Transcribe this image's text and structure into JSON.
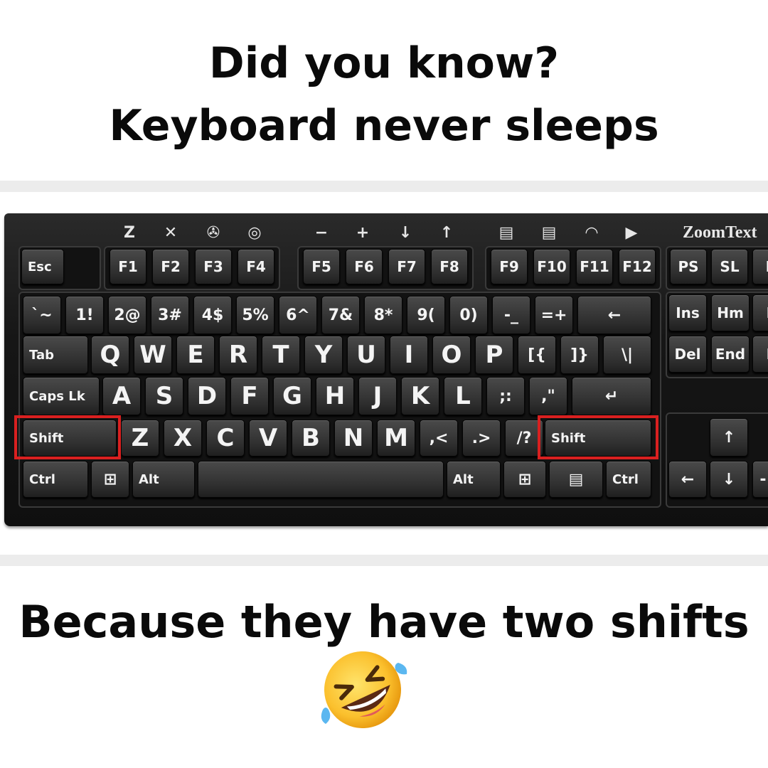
{
  "headline": {
    "line1": "Did you know?",
    "line2": "Keyboard never sleeps"
  },
  "punchline": "Because they have two shifts",
  "emoji": "rolling-on-the-floor-laughing",
  "keyboard": {
    "brand": "ZoomText",
    "top_icons": [
      "Z",
      "✕",
      "✇",
      "◎",
      "−",
      "+",
      "↓",
      "↑",
      "▤",
      "▤",
      "◠",
      "▶"
    ],
    "function_row": [
      "Esc",
      "F1",
      "F2",
      "F3",
      "F4",
      "F5",
      "F6",
      "F7",
      "F8",
      "F9",
      "F10",
      "F11",
      "F12",
      "PS",
      "SL",
      "P"
    ],
    "number_row": [
      "`~",
      "1!",
      "2@",
      "3#",
      "4$",
      "5%",
      "6^",
      "7&",
      "8*",
      "9(",
      "0)",
      "-_",
      "=+",
      "←"
    ],
    "qwerty_row": [
      "Tab",
      "Q",
      "W",
      "E",
      "R",
      "T",
      "Y",
      "U",
      "I",
      "O",
      "P",
      "[{",
      "]}",
      "\\|"
    ],
    "home_row": [
      "Caps Lk",
      "A",
      "S",
      "D",
      "F",
      "G",
      "H",
      "J",
      "K",
      "L",
      ";:",
      ",\"",
      "↵"
    ],
    "shift_row": [
      "Shift",
      "Z",
      "X",
      "C",
      "V",
      "B",
      "N",
      "M",
      ",<",
      ".>",
      "/?",
      "Shift"
    ],
    "bottom_row": [
      "Ctrl",
      "⊞",
      "Alt",
      "",
      "Alt",
      "⊞",
      "▤",
      "Ctrl"
    ],
    "nav_keys": [
      "Ins",
      "Hm",
      "P",
      "Del",
      "End",
      "P"
    ],
    "arrow_keys": [
      "↑",
      "←",
      "↓",
      "-"
    ]
  },
  "colors": {
    "highlight": "#d92020",
    "background": "#ffffff",
    "text": "#0a0a0a"
  }
}
